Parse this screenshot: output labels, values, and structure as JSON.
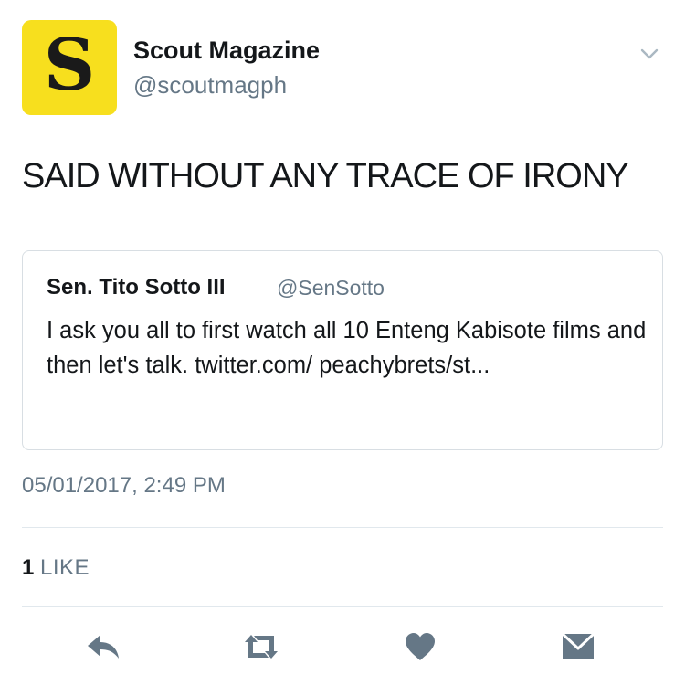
{
  "user": {
    "avatar_letter": "S",
    "avatar_color": "#f7df1e",
    "name": "Scout Magazine",
    "handle": "@scoutmagph"
  },
  "tweet": {
    "text": "SAID WITHOUT ANY TRACE OF IRONY",
    "timestamp": "05/01/2017, 2:49 PM"
  },
  "quoted_tweet": {
    "name": "Sen. Tito Sotto III",
    "handle": "@SenSotto",
    "text": "I ask you all to first watch all 10 Enteng Kabisote films and then let's talk. twitter.com/ peachybrets/st..."
  },
  "engagement": {
    "like_count": "1",
    "like_label": "LIKE"
  },
  "icons": {
    "menu": "chevron-down-icon",
    "reply": "reply-icon",
    "retweet": "retweet-icon",
    "like": "heart-icon",
    "dm": "envelope-icon",
    "icon_color": "#657786"
  }
}
